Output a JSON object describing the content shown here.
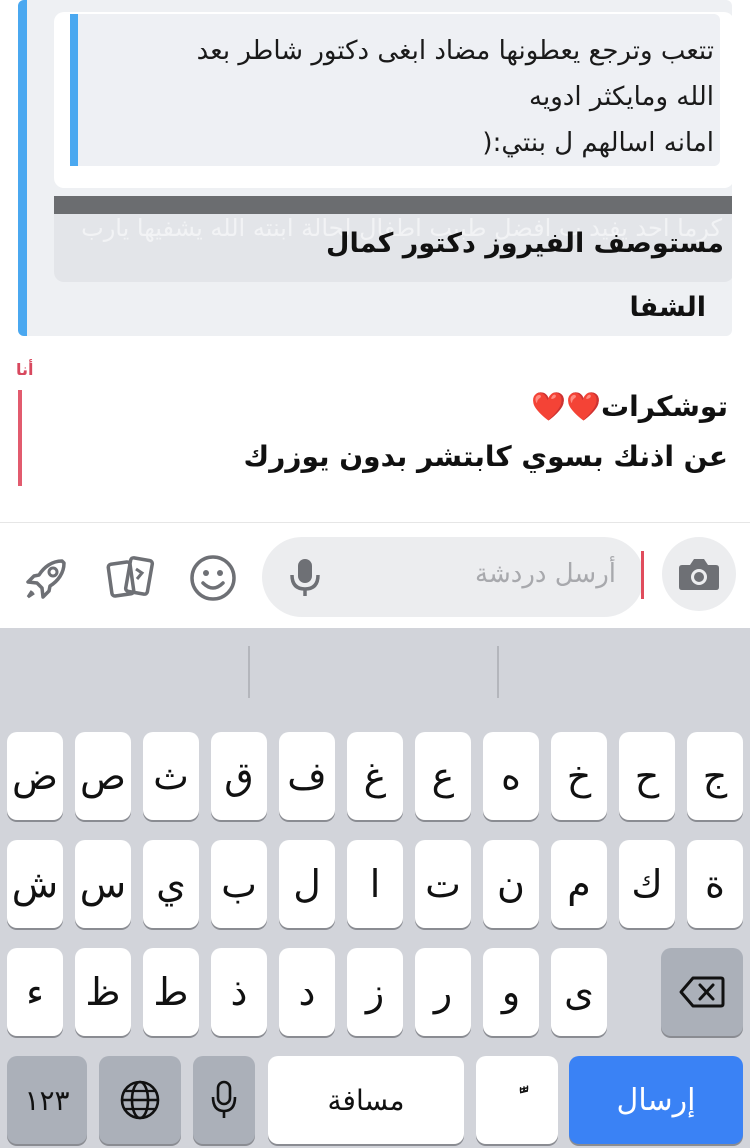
{
  "quote": {
    "inner_lines": [
      "تتعب وترجع يعطونها مضاد ابغى دكتور شاطر بعد",
      "الله ومايكثر ادويه",
      "امانه اسالهم ل بنتي:("
    ],
    "story_overlay": "كرما احد يفيد ب افضل طبيب اطفال لحالة ابنته الله يشفيها يارب",
    "story_main": "مستوصف الفيروز دكتور كمال",
    "tail": "الشفا"
  },
  "my_message": {
    "sender": "أنا",
    "line1_text": "توشكرات",
    "line1_hearts": "❤️❤️",
    "line2": "عن اذنك بسوي كابتشر بدون يوزرك"
  },
  "input": {
    "placeholder": "أرسل دردشة",
    "icons": [
      "rocket-icon",
      "cards-icon",
      "smiley-icon",
      "mic-icon",
      "camera-icon"
    ]
  },
  "keyboard": {
    "row1": [
      "ض",
      "ص",
      "ث",
      "ق",
      "ف",
      "غ",
      "ع",
      "ه",
      "خ",
      "ح",
      "ج"
    ],
    "row2": [
      "ش",
      "س",
      "ي",
      "ب",
      "ل",
      "ا",
      "ت",
      "ن",
      "م",
      "ك",
      "ة"
    ],
    "row3": [
      "ء",
      "ظ",
      "ط",
      "ذ",
      "د",
      "ز",
      "ر",
      "و",
      "ى"
    ],
    "numbers_label": "١٢٣",
    "space_label": "مسافة",
    "diacritic_label": "ًّ",
    "send_label": "إرسال"
  },
  "colors": {
    "quote_accent": "#4aa8f0",
    "my_accent": "#e25b6e",
    "send_key": "#3a82f5",
    "keyboard_bg": "#d2d4da"
  }
}
